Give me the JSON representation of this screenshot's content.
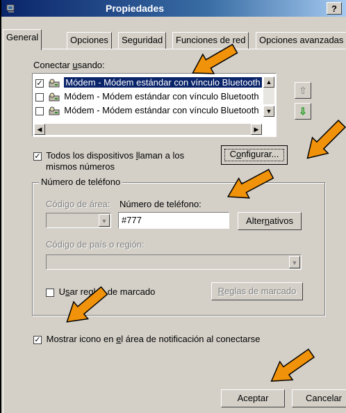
{
  "window": {
    "title": "Propiedades",
    "help_label": "?"
  },
  "tabs": [
    {
      "label": "General",
      "active": true
    },
    {
      "label": "Opciones",
      "active": false
    },
    {
      "label": "Seguridad",
      "active": false
    },
    {
      "label": "Funciones de red",
      "active": false
    },
    {
      "label": "Opciones avanzadas",
      "active": false
    }
  ],
  "connect": {
    "label_prefix": "Conectar ",
    "label_u": "u",
    "label_suffix": "sando:",
    "devices": [
      {
        "label": "Módem - Módem estándar con vínculo Bluetooth",
        "checked": true,
        "selected": true
      },
      {
        "label": "Módem - Módem estándar con vínculo Bluetooth",
        "checked": false,
        "selected": false
      },
      {
        "label": "Módem - Módem estándar con vínculo Bluetooth",
        "checked": false,
        "selected": false
      }
    ]
  },
  "all_devices": {
    "checked": true,
    "line1_prefix": "Todos los dispositivos ",
    "line1_u": "l",
    "line1_suffix": "laman a los",
    "line2": "mismos números"
  },
  "configure_button": {
    "prefix": "C",
    "u": "o",
    "suffix": "nfigurar..."
  },
  "phone_group": {
    "title": "Número de teléfono",
    "area_code_label": "Código de área:",
    "phone_number_label": "Número de teléfono:",
    "phone_number_value": "#777",
    "alternates_button": {
      "prefix": "Alter",
      "u": "n",
      "suffix": "ativos"
    },
    "country_label": "Código de país o región:",
    "use_dialing_rules": {
      "checked": false,
      "prefix": "U",
      "u": "s",
      "suffix": "ar reglas de marcado"
    },
    "dialing_rules_button": {
      "prefix": "",
      "u": "R",
      "suffix": "eglas de marcado"
    }
  },
  "show_icon": {
    "checked": true,
    "prefix": "Mostrar icono en ",
    "u": "e",
    "suffix": "l área de notificación al conectarse"
  },
  "footer": {
    "ok_label": "Aceptar",
    "cancel_label": "Cancelar"
  },
  "annotation_color": "#f0920a",
  "accent": "#0a246a"
}
